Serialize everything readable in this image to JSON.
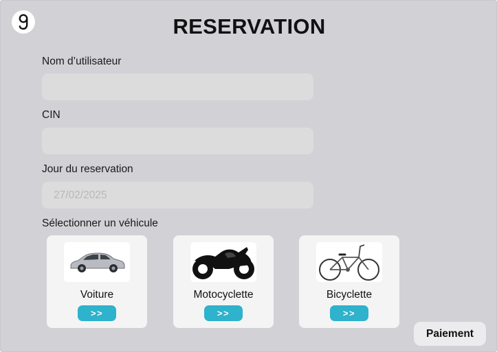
{
  "header": {
    "title": "RESERVATION",
    "logo_icon": "g-logo-icon"
  },
  "form": {
    "username": {
      "label": "Nom d’utilisateur",
      "value": "",
      "placeholder": ""
    },
    "cin": {
      "label": "CIN",
      "value": "",
      "placeholder": ""
    },
    "date": {
      "label": "Jour du reservation",
      "value": "",
      "placeholder": "27/02/2025"
    },
    "vehicle_label": "Sélectionner un véhicule"
  },
  "vehicles": [
    {
      "name": "Voiture",
      "button": ">>",
      "icon": "car-icon"
    },
    {
      "name": "Motocyclette",
      "button": ">>",
      "icon": "motorcycle-icon"
    },
    {
      "name": "Bicyclette",
      "button": ">>",
      "icon": "bicycle-icon"
    }
  ],
  "footer": {
    "pay_label": "Paiement"
  },
  "colors": {
    "background": "#d2d1d6",
    "field": "#dcdcdd",
    "card": "#f4f4f5",
    "accent": "#2fb2cb"
  }
}
